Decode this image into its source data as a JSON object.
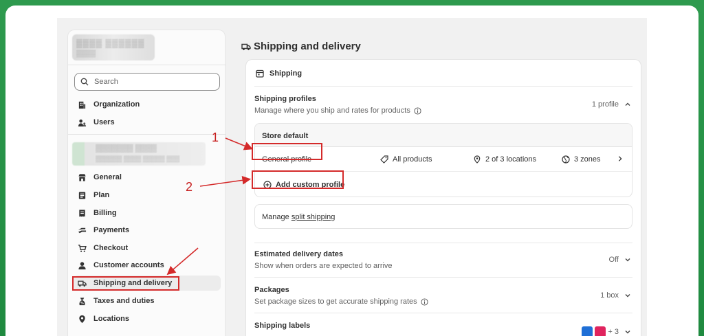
{
  "sidebar": {
    "search_placeholder": "Search",
    "items": [
      {
        "label": "Organization",
        "icon": "building-icon"
      },
      {
        "label": "Users",
        "icon": "users-icon"
      },
      {
        "label": "General",
        "icon": "store-icon"
      },
      {
        "label": "Plan",
        "icon": "plan-icon"
      },
      {
        "label": "Billing",
        "icon": "billing-icon"
      },
      {
        "label": "Payments",
        "icon": "payments-icon"
      },
      {
        "label": "Checkout",
        "icon": "cart-icon"
      },
      {
        "label": "Customer accounts",
        "icon": "person-icon"
      },
      {
        "label": "Shipping and delivery",
        "icon": "truck-icon"
      },
      {
        "label": "Taxes and duties",
        "icon": "tax-icon"
      },
      {
        "label": "Locations",
        "icon": "location-pin-icon"
      }
    ]
  },
  "main": {
    "page_title": "Shipping and delivery",
    "card_title": "Shipping",
    "profiles": {
      "title": "Shipping profiles",
      "desc": "Manage where you ship and rates for products",
      "count": "1 profile",
      "group_header": "Store default",
      "general": {
        "name": "General profile",
        "products": "All products",
        "locations": "2 of 3 locations",
        "zones": "3 zones"
      },
      "add_label": "Add custom profile"
    },
    "split": {
      "prefix": "Manage ",
      "link": "split shipping"
    },
    "delivery_dates": {
      "title": "Estimated delivery dates",
      "desc": "Show when orders are expected to arrive",
      "value": "Off"
    },
    "packages": {
      "title": "Packages",
      "desc": "Set package sizes to get accurate shipping rates",
      "value": "1 box"
    },
    "labels": {
      "title": "Shipping labels",
      "extra": "+ 3"
    }
  },
  "annotations": {
    "one": "1",
    "two": "2",
    "color": "#d42a2a"
  }
}
